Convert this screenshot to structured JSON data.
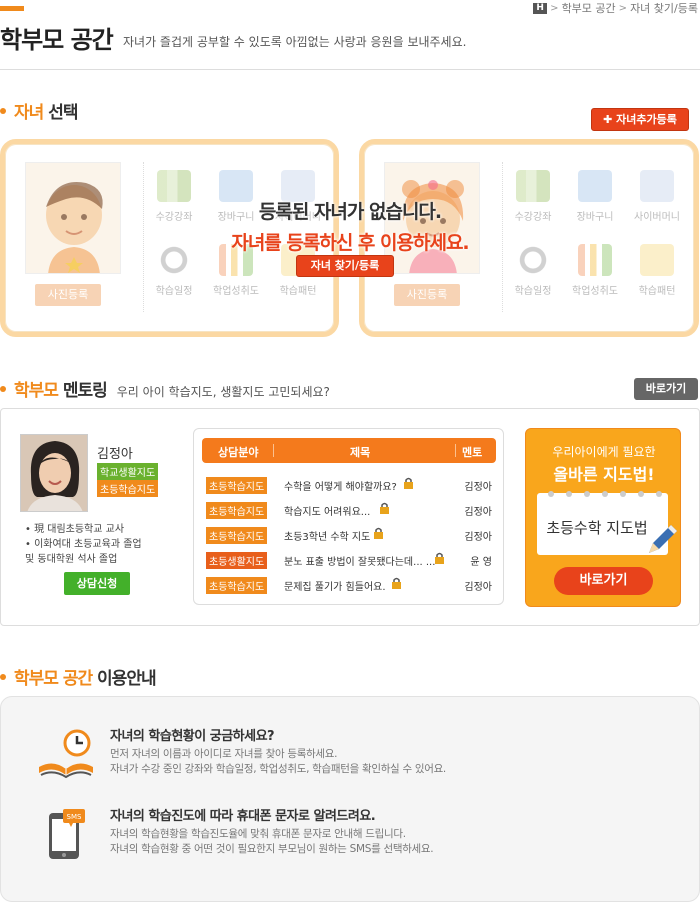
{
  "header": {
    "title": "학부모 공간",
    "subtitle": "자녀가 즐겁게 공부할 수 있도록 아낌없는 사랑과 응원을 보내주세요.",
    "breadcrumb": [
      "학부모 공간",
      "자녀 찾기/등록"
    ],
    "home_badge": "H"
  },
  "child_select": {
    "title_hl": "자녀",
    "title_rest": "선택",
    "add_button": "✚ 자녀추가등록",
    "photo_button": "사진등록",
    "menu": [
      "수강강좌",
      "장바구니",
      "사이버머니",
      "학습일정",
      "학업성취도",
      "학습패턴"
    ],
    "empty_line1": "등록된 자녀가 없습니다.",
    "empty_line2": "자녀를 등록하신 후 이용하세요.",
    "find_button": "자녀 찾기/등록"
  },
  "mentoring": {
    "title_hl": "학부모",
    "title_rest": "멘토링",
    "desc": "우리 아이 학습지도, 생활지도 고민되세요?",
    "go_button": "바로가기",
    "mentor": {
      "name": "김정아",
      "tags": [
        "학교생활지도",
        "초등학습지도"
      ],
      "info": [
        "• 現 대림초등학교 교사",
        "• 이화여대 초등교육과 졸업",
        "   및 동대학원 석사 졸업"
      ],
      "consult_button": "상담신청"
    },
    "table": {
      "headers": [
        "상담분야",
        "제목",
        "멘토"
      ],
      "rows": [
        {
          "category": "초등학습지도",
          "title": "수학을 어떻게 해야할까요?",
          "mentor": "김정아",
          "dark": false
        },
        {
          "category": "초등학습지도",
          "title": "학습지도 어려워요...",
          "mentor": "김정아",
          "dark": false
        },
        {
          "category": "초등학습지도",
          "title": "초등3학년 수학 지도",
          "mentor": "김정아",
          "dark": false
        },
        {
          "category": "초등생활지도",
          "title": "분노 표출 방법이 잘못됐다는데... ...",
          "mentor": "윤 영",
          "dark": true
        },
        {
          "category": "초등학습지도",
          "title": "문제집 풀기가 힘들어요.",
          "mentor": "김정아",
          "dark": false
        }
      ]
    },
    "promo": {
      "line1": "우리아이에게 필요한",
      "line2": "올바른 지도법!",
      "note": "초등수학 지도법",
      "button": "바로가기"
    }
  },
  "guide": {
    "title_hl": "학부모 공간",
    "title_rest": "이용안내",
    "items": [
      {
        "title": "자녀의 학습현황이 궁금하세요?",
        "desc1": "먼저 자녀의 이름과 아이디로 자녀를 찾아 등록하세요.",
        "desc2": "자녀가 수강 중인 강좌와 학습일정, 학업성취도, 학습패턴을 확인하실 수 있어요."
      },
      {
        "title": "자녀의 학습진도에 따라 휴대폰 문자로 알려드려요.",
        "desc1": "자녀의 학습현황을 학습진도율에 맞춰 휴대폰 문자로 안내해 드립니다.",
        "desc2": "자녀의 학습현황 중 어떤 것이 필요한지 부모님이 원하는 SMS를 선택하세요.",
        "icon_text": "SMS"
      }
    ]
  },
  "colors": {
    "accent": "#f08a1c",
    "red": "#e8431b",
    "green": "#43b02a"
  }
}
